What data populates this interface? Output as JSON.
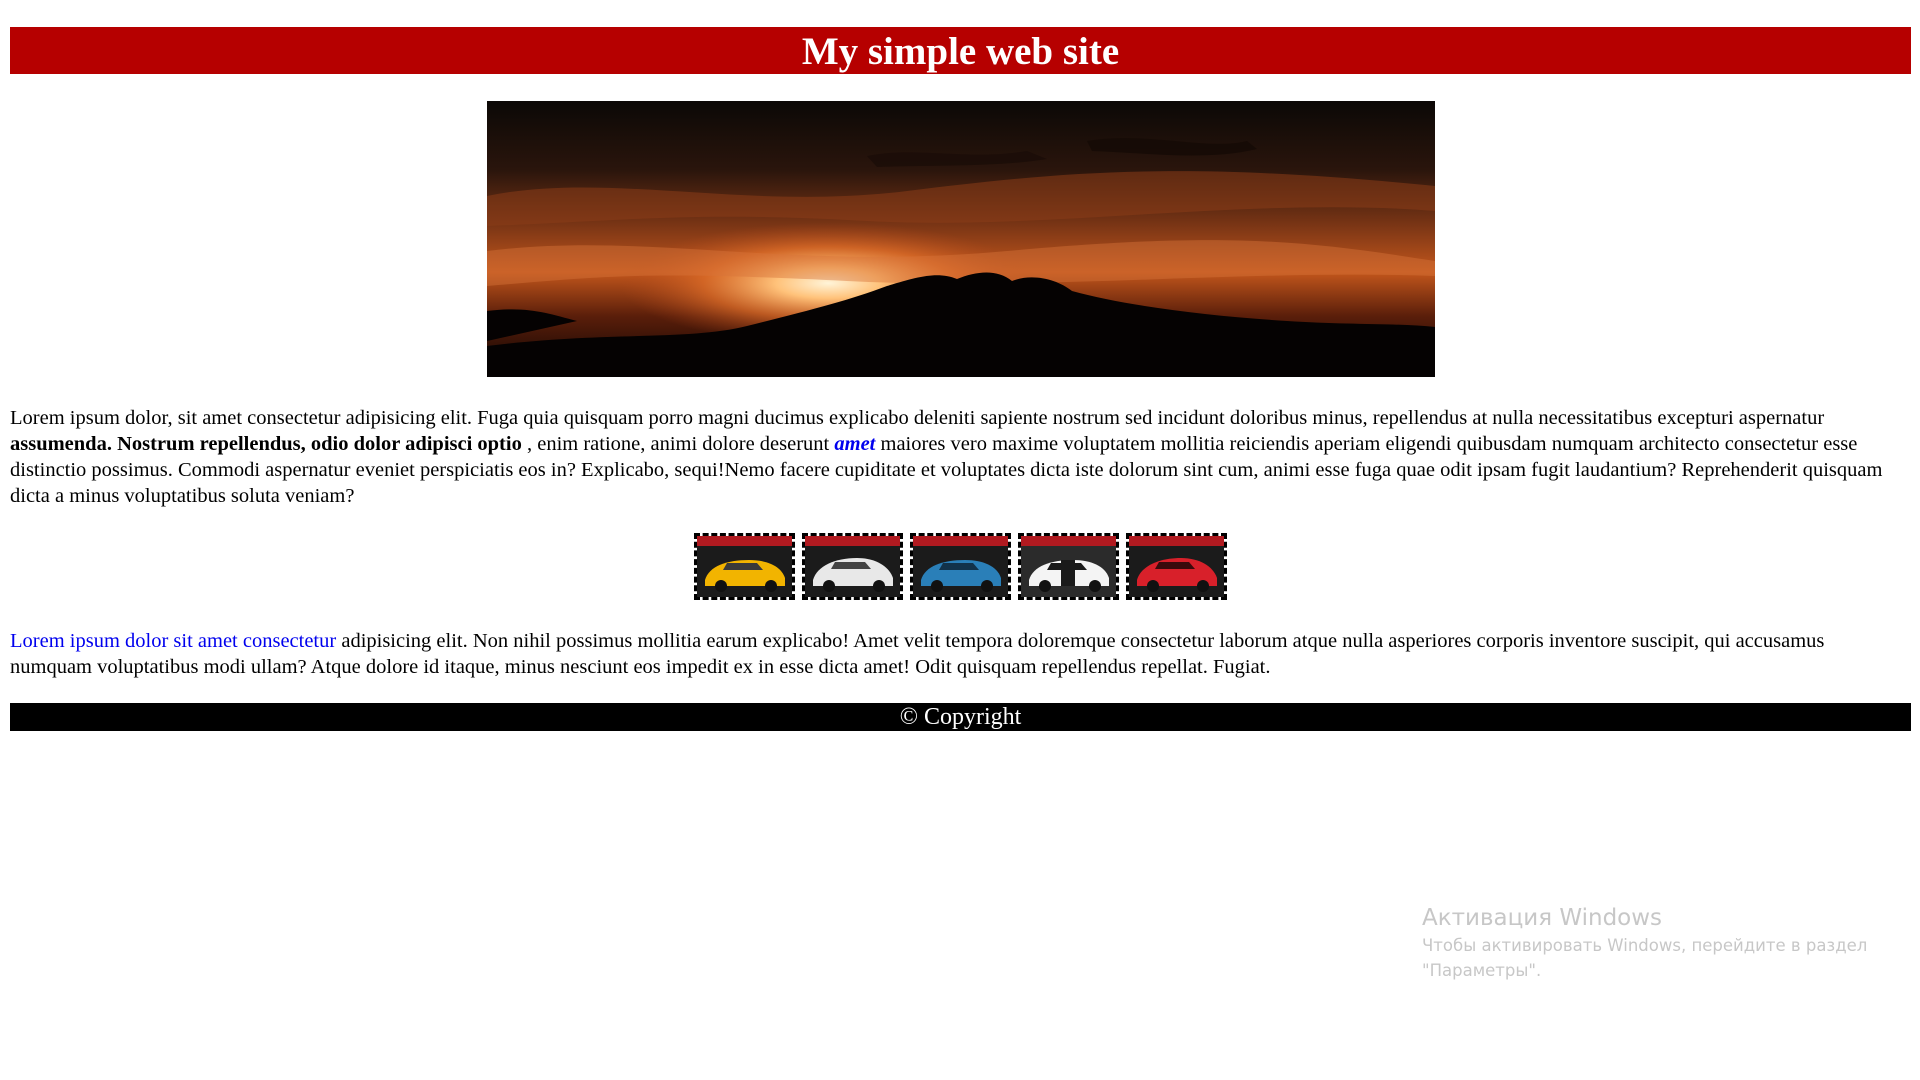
{
  "colors": {
    "header_bg": "#b60000",
    "footer_bg": "#000000",
    "link": "#0000ee"
  },
  "header": {
    "title": "My simple web site"
  },
  "banner": {
    "icon": "sunset-landscape-image"
  },
  "paragraph1": {
    "text_a": "Lorem ipsum dolor, sit amet consectetur adipisicing elit. Fuga quia quisquam porro magni ducimus explicabo deleniti sapiente nostrum sed incidunt doloribus minus, repellendus at nulla necessitatibus excepturi aspernatur ",
    "bold": "assumenda. Nostrum repellendus, odio dolor adipisci optio",
    "text_b": " , enim ratione, animi dolore deserunt ",
    "link": "amet",
    "text_c": " maiores vero maxime voluptatem mollitia reiciendis aperiam eligendi quibusdam numquam architecto consectetur esse distinctio possimus. Commodi aspernatur eveniet perspiciatis eos in? Explicabo, sequi!Nemo facere cupiditate et voluptates dicta iste dolorum sint cum, animi esse fuga quae odit ipsam fugit laudantium? Reprehenderit quisquam dicta a minus voluptatibus soluta veniam?"
  },
  "gallery": {
    "items": [
      {
        "icon": "yellow-car-image",
        "color": "#f2b400"
      },
      {
        "icon": "white-car-image",
        "color": "#e8e8e8"
      },
      {
        "icon": "blue-car-image",
        "color": "#2a7fb8"
      },
      {
        "icon": "black-white-car-image",
        "color": "#1a1a1a"
      },
      {
        "icon": "red-car-image",
        "color": "#d8202a"
      }
    ]
  },
  "paragraph2": {
    "link": "Lorem ipsum dolor sit amet consectetur",
    "text": " adipisicing elit. Non nihil possimus mollitia earum explicabo! Amet velit tempora doloremque consectetur laborum atque nulla asperiores corporis inventore suscipit, qui accusamus numquam voluptatibus modi ullam? Atque dolore id itaque, minus nesciunt eos impedit ex in esse dicta amet! Odit quisquam repellendus repellat. Fugiat."
  },
  "footer": {
    "text": "© Copyright"
  },
  "watermark": {
    "title": "Активация Windows",
    "line1": "Чтобы активировать Windows, перейдите в раздел",
    "line2": "\"Параметры\"."
  }
}
